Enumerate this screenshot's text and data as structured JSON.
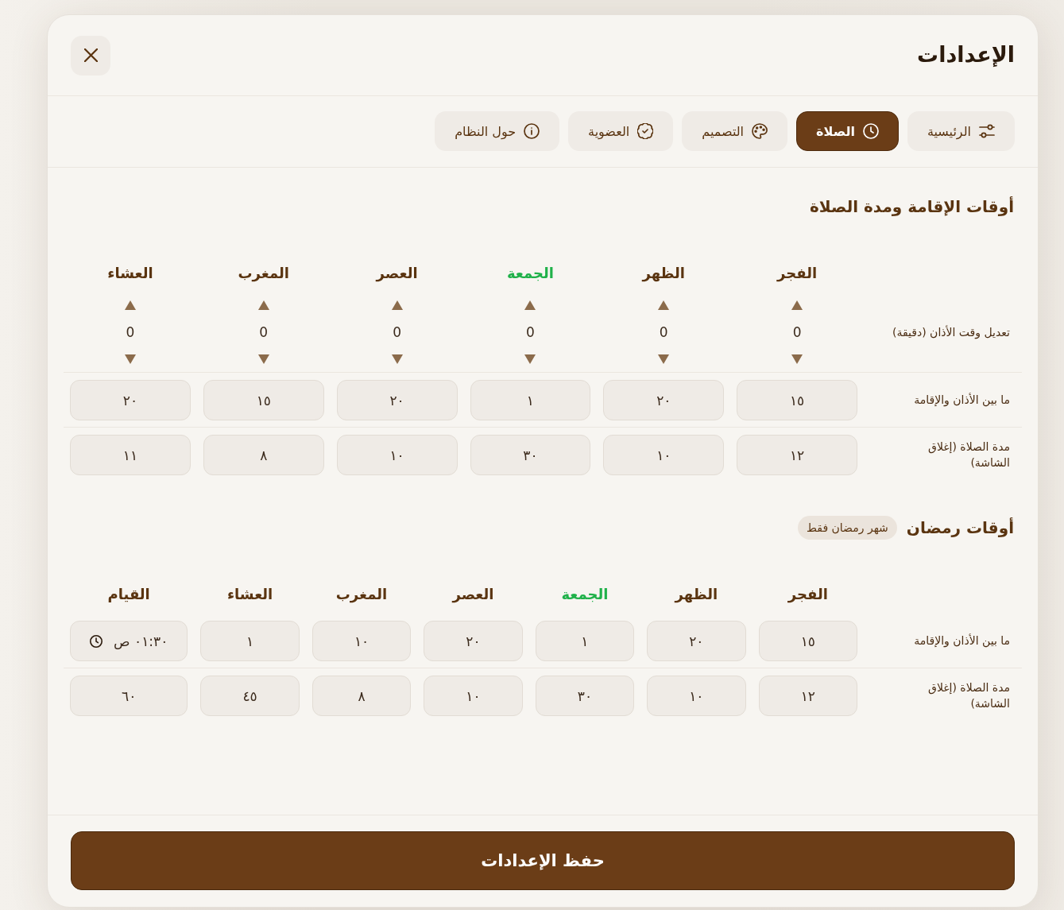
{
  "window": {
    "title": "الإعدادات"
  },
  "tabs": [
    {
      "label": "الرئيسية",
      "selected": false
    },
    {
      "label": "الصلاة",
      "selected": true
    },
    {
      "label": "التصميم",
      "selected": false
    },
    {
      "label": "العضوية",
      "selected": false
    },
    {
      "label": "حول النظام",
      "selected": false
    }
  ],
  "sections": [
    {
      "title": "أوقات الإقامة ومدة الصلاة",
      "columns": [
        {
          "label": "الفجر",
          "color": "#5a3410"
        },
        {
          "label": "الظهر",
          "color": "#5a3410"
        },
        {
          "label": "الجمعة",
          "color": "#20b14a"
        },
        {
          "label": "العصر",
          "color": "#5a3410"
        },
        {
          "label": "المغرب",
          "color": "#5a3410"
        },
        {
          "label": "العشاء",
          "color": "#5a3410"
        }
      ],
      "rows": [
        {
          "label": "تعديل وقت الأذان (دقيقة)",
          "cells": [
            {
              "kind": "stepper",
              "value": "0"
            },
            {
              "kind": "stepper",
              "value": "0"
            },
            {
              "kind": "stepper",
              "value": "0"
            },
            {
              "kind": "stepper",
              "value": "0"
            },
            {
              "kind": "stepper",
              "value": "0"
            },
            {
              "kind": "stepper",
              "value": "0"
            }
          ]
        },
        {
          "label": "ما بين الأذان والإقامة",
          "cells": [
            {
              "kind": "number",
              "value": "١٥"
            },
            {
              "kind": "number",
              "value": "٢٠"
            },
            {
              "kind": "number",
              "value": "١"
            },
            {
              "kind": "number",
              "value": "٢٠"
            },
            {
              "kind": "number",
              "value": "١٥"
            },
            {
              "kind": "number",
              "value": "٢٠"
            }
          ]
        },
        {
          "label": "مدة الصلاة (إغلاق الشاشة)",
          "cells": [
            {
              "kind": "number",
              "value": "١٢"
            },
            {
              "kind": "number",
              "value": "١٠"
            },
            {
              "kind": "number",
              "value": "٣٠"
            },
            {
              "kind": "number",
              "value": "١٠"
            },
            {
              "kind": "number",
              "value": "٨"
            },
            {
              "kind": "number",
              "value": "١١"
            }
          ]
        }
      ]
    },
    {
      "title": "أوقات رمضان",
      "badge": "شهر رمضان فقط",
      "columns": [
        {
          "label": "الفجر",
          "color": "#5a3410"
        },
        {
          "label": "الظهر",
          "color": "#5a3410"
        },
        {
          "label": "الجمعة",
          "color": "#20b14a"
        },
        {
          "label": "العصر",
          "color": "#5a3410"
        },
        {
          "label": "المغرب",
          "color": "#5a3410"
        },
        {
          "label": "العشاء",
          "color": "#5a3410"
        },
        {
          "label": "القيام",
          "color": "#5a3410"
        }
      ],
      "rows": [
        {
          "label": "ما بين الأذان والإقامة",
          "cells": [
            {
              "kind": "number",
              "value": "١٥"
            },
            {
              "kind": "number",
              "value": "٢٠"
            },
            {
              "kind": "number",
              "value": "١"
            },
            {
              "kind": "number",
              "value": "٢٠"
            },
            {
              "kind": "number",
              "value": "١٠"
            },
            {
              "kind": "number",
              "value": "١"
            },
            {
              "kind": "time",
              "value": "٠١:٣٠ ص"
            }
          ]
        },
        {
          "label": "مدة الصلاة (إغلاق الشاشة)",
          "cells": [
            {
              "kind": "number",
              "value": "١٢"
            },
            {
              "kind": "number",
              "value": "١٠"
            },
            {
              "kind": "number",
              "value": "٣٠"
            },
            {
              "kind": "number",
              "value": "١٠"
            },
            {
              "kind": "number",
              "value": "٨"
            },
            {
              "kind": "number",
              "value": "٤٥"
            },
            {
              "kind": "number",
              "value": "٦٠"
            }
          ]
        }
      ]
    }
  ],
  "save_button": "حفظ الإعدادات"
}
